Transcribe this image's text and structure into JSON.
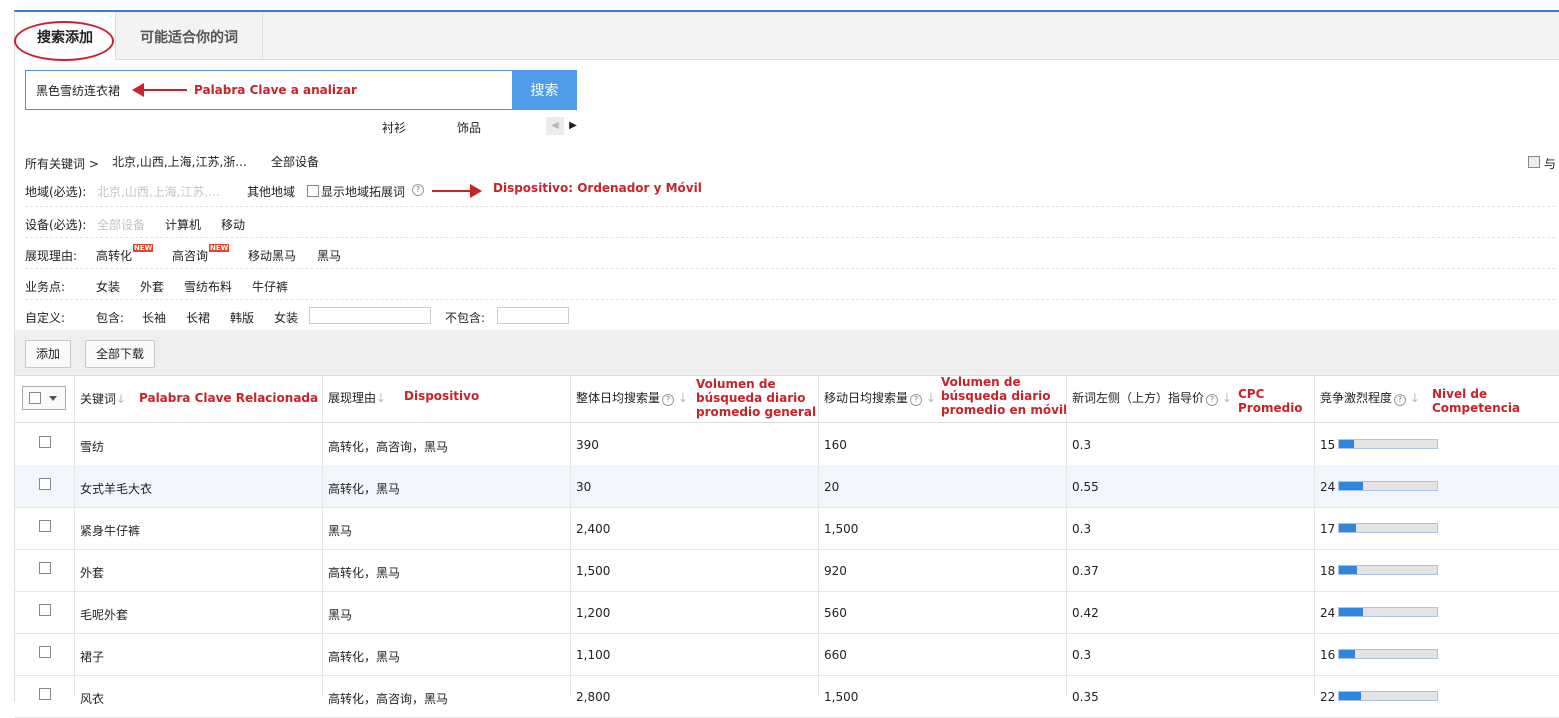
{
  "tabs": {
    "add": "搜索添加",
    "suggest": "可能适合你的词"
  },
  "search": {
    "value": "黑色雪纺连衣裙",
    "button": "搜索",
    "annotation": "Palabra Clave a analizar"
  },
  "suggestions": [
    "衬衫",
    "饰品"
  ],
  "breadcrumb": {
    "all": "所有关键词 >",
    "region": "北京,山西,上海,江苏,浙...",
    "device": "全部设备",
    "corner": "与"
  },
  "region_row": {
    "label": "地域(必选):",
    "placeholder": "北京,山西,上海,江苏,...",
    "other": "其他地域",
    "show_ext": "显示地域拓展词",
    "annotation": "Dispositivo: Ordenador y Móvil"
  },
  "device_row": {
    "label": "设备(必选):",
    "all": "全部设备",
    "pc": "计算机",
    "mobile": "移动"
  },
  "reason_row": {
    "label": "展现理由:",
    "items": [
      "高转化",
      "高咨询",
      "移动黑马",
      "黑马"
    ],
    "new_badge": "NEW"
  },
  "business_row": {
    "label": "业务点:",
    "items": [
      "女装",
      "外套",
      "雪纺布料",
      "牛仔裤"
    ]
  },
  "custom_row": {
    "label": "自定义:",
    "include": "包含:",
    "items": [
      "长袖",
      "长裙",
      "韩版",
      "女装"
    ],
    "exclude": "不包含:"
  },
  "toolbar": {
    "add": "添加",
    "download": "全部下载"
  },
  "table": {
    "headers": {
      "keyword": "关键词",
      "keyword_note": "Palabra Clave Relacionada",
      "reason": "展现理由",
      "reason_note": "Dispositivo",
      "total": "整体日均搜索量",
      "total_note": [
        "Volumen de",
        "búsqueda diario",
        "promedio general"
      ],
      "mobile": "移动日均搜索量",
      "mobile_note": [
        "Volumen de",
        "búsqueda diario",
        "promedio en móvil"
      ],
      "cpc": "新词左侧（上方）指导价",
      "cpc_note": [
        "CPC",
        "Promedio"
      ],
      "comp": "竞争激烈程度",
      "comp_note": [
        "Nivel de",
        "Competencia"
      ]
    },
    "rows": [
      {
        "keyword": "雪纺",
        "reason": "高转化，高咨询，黑马",
        "total": "390",
        "mobile": "160",
        "cpc": "0.3",
        "comp": "15",
        "level": 15
      },
      {
        "keyword": "女式羊毛大衣",
        "reason": "高转化，黑马",
        "total": "30",
        "mobile": "20",
        "cpc": "0.55",
        "comp": "24",
        "level": 24
      },
      {
        "keyword": "紧身牛仔裤",
        "reason": "黑马",
        "total": "2,400",
        "mobile": "1,500",
        "cpc": "0.3",
        "comp": "17",
        "level": 17
      },
      {
        "keyword": "外套",
        "reason": "高转化，黑马",
        "total": "1,500",
        "mobile": "920",
        "cpc": "0.37",
        "comp": "18",
        "level": 18
      },
      {
        "keyword": "毛呢外套",
        "reason": "黑马",
        "total": "1,200",
        "mobile": "560",
        "cpc": "0.42",
        "comp": "24",
        "level": 24
      },
      {
        "keyword": "裙子",
        "reason": "高转化，黑马",
        "total": "1,100",
        "mobile": "660",
        "cpc": "0.3",
        "comp": "16",
        "level": 16
      },
      {
        "keyword": "风衣",
        "reason": "高转化，高咨询，黑马",
        "total": "2,800",
        "mobile": "1,500",
        "cpc": "0.35",
        "comp": "22",
        "level": 22
      }
    ]
  },
  "colors": {
    "accent": "#2f7fd6",
    "annotation": "#c8232c",
    "bar": "#2e86e0",
    "row_alt": "#f1f6fd"
  }
}
